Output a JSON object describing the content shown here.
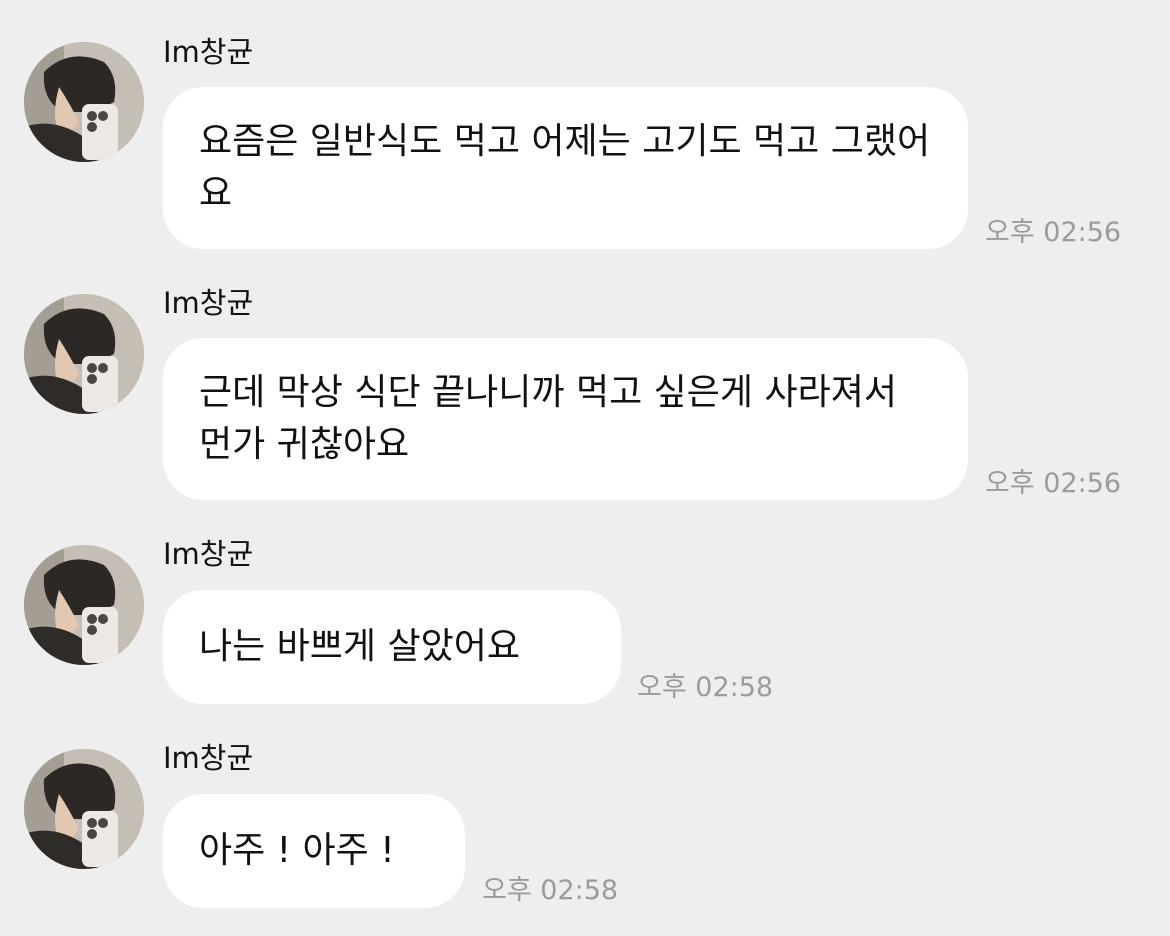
{
  "messages": [
    {
      "sender": "Im창균",
      "text": "요즘은 일반식도 먹고 어제는 고기도 먹고 그랬어요",
      "time": "오후 02:56"
    },
    {
      "sender": "Im창균",
      "text": "근데 막상 식단 끝나니까 먹고 싶은게 사라져서 먼가 귀찮아요",
      "time": "오후 02:56"
    },
    {
      "sender": "Im창균",
      "text": "나는 바쁘게 살았어요",
      "time": "오후 02:58"
    },
    {
      "sender": "Im창균",
      "text": "아주 ! 아주 !",
      "time": "오후 02:58"
    }
  ],
  "colors": {
    "background": "#eeeeee",
    "bubble": "#ffffff",
    "text": "#111111",
    "time": "#9b9b9b"
  }
}
